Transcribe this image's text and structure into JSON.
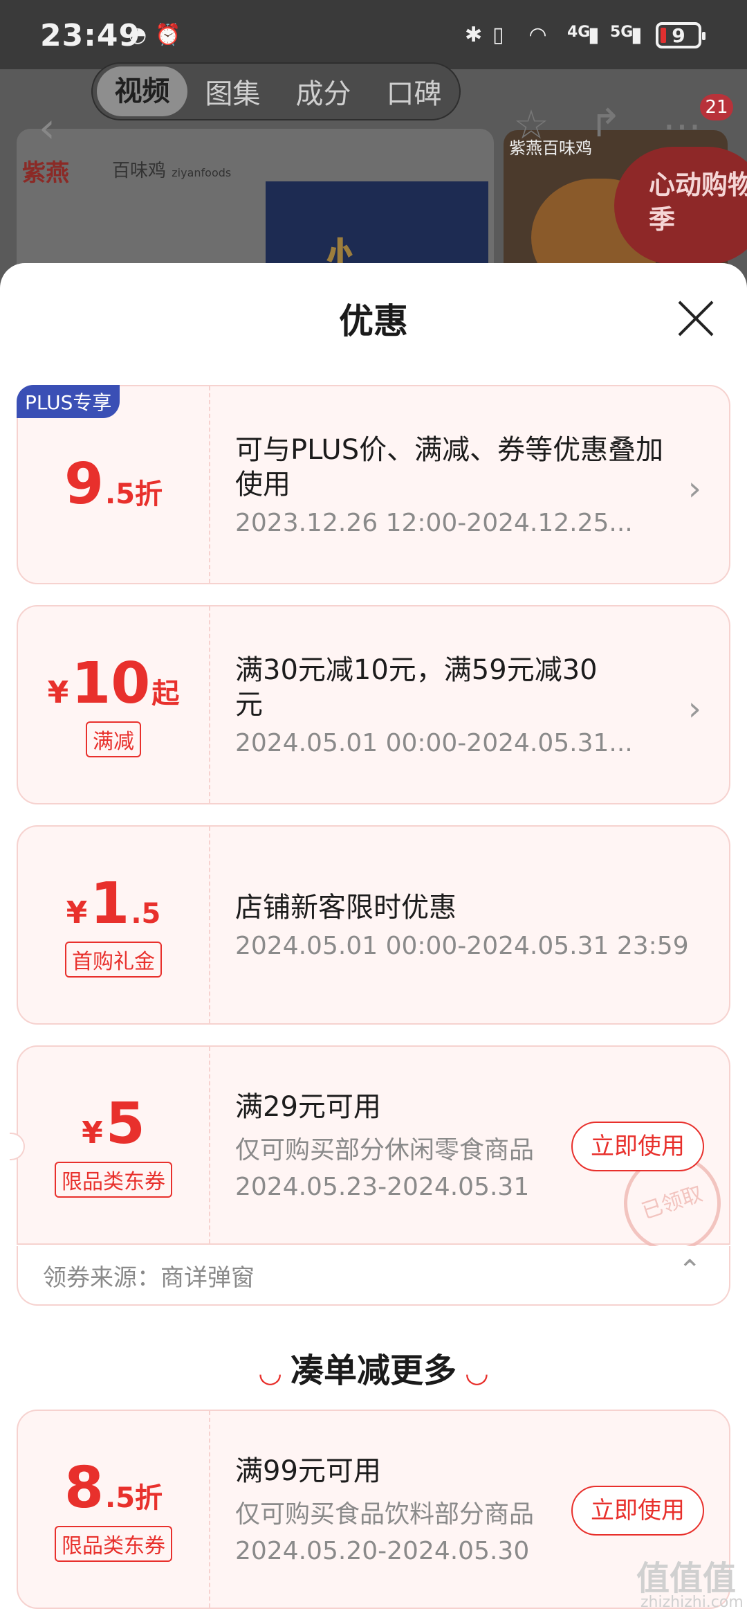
{
  "status_bar": {
    "time": "23:49",
    "network_4g": "4G",
    "network_5g": "5G",
    "battery": "9"
  },
  "top_tabs": [
    "视频",
    "图集",
    "成分",
    "口碑"
  ],
  "header_badge": "21",
  "background": {
    "brand": "紫燕",
    "brand_sub": "百味鸡",
    "brand_en": "ziyanfoods",
    "thumb_label": "紫燕百味鸡",
    "promo": "心动购物季"
  },
  "sheet": {
    "title": "优惠",
    "coupons": [
      {
        "badge": "PLUS专享",
        "num": "9",
        "suffix": ".5折",
        "title": "可与PLUS价、满减、券等优惠叠加使用",
        "date": "2023.12.26 12:00-2024.12.25..."
      },
      {
        "currency": "¥",
        "num": "10",
        "suffix": "起",
        "tag": "满减",
        "title": "满30元减10元，满59元减30元",
        "date": "2024.05.01 00:00-2024.05.31..."
      },
      {
        "currency": "¥",
        "num": "1",
        "suffix": ".5",
        "tag": "首购礼金",
        "title": "店铺新客限时优惠",
        "date": "2024.05.01 00:00-2024.05.31 23:59"
      },
      {
        "currency": "¥",
        "num": "5",
        "tag": "限品类东券",
        "title": "满29元可用",
        "sub": "仅可购买部分休闲零食商品",
        "date": "2024.05.23-2024.05.31",
        "button": "立即使用",
        "stamp": "已领取"
      }
    ],
    "source": "领券来源：商详弹窗",
    "section_title": "凑单减更多",
    "more_coupons": [
      {
        "num": "8",
        "suffix": ".5折",
        "tag": "限品类东券",
        "title": "满99元可用",
        "sub": "仅可购买食品饮料部分商品",
        "date": "2024.05.20-2024.05.30",
        "button": "立即使用"
      }
    ]
  },
  "watermark": "值值值",
  "watermark_sub": "zhizhizhi.com"
}
